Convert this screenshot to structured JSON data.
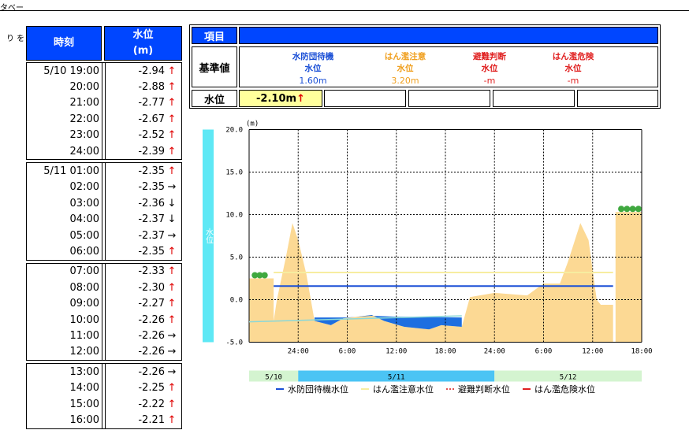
{
  "header": {
    "fragment": "タベー",
    "side_note": "り を"
  },
  "time_table": {
    "col_time": "時刻",
    "col_level": "水位",
    "col_level_unit": "(m)",
    "groups": [
      {
        "rows": [
          {
            "time": "5/10 19:00",
            "value": "-2.94",
            "trend": "↑"
          },
          {
            "time": "20:00",
            "value": "-2.88",
            "trend": "↑"
          },
          {
            "time": "21:00",
            "value": "-2.77",
            "trend": "↑"
          },
          {
            "time": "22:00",
            "value": "-2.67",
            "trend": "↑"
          },
          {
            "time": "23:00",
            "value": "-2.52",
            "trend": "↑"
          },
          {
            "time": "24:00",
            "value": "-2.39",
            "trend": "↑"
          }
        ]
      },
      {
        "rows": [
          {
            "time": "5/11 01:00",
            "value": "-2.35",
            "trend": "↑"
          },
          {
            "time": "02:00",
            "value": "-2.35",
            "trend": "→"
          },
          {
            "time": "03:00",
            "value": "-2.36",
            "trend": "↓"
          },
          {
            "time": "04:00",
            "value": "-2.37",
            "trend": "↓"
          },
          {
            "time": "05:00",
            "value": "-2.37",
            "trend": "→"
          },
          {
            "time": "06:00",
            "value": "-2.35",
            "trend": "↑"
          }
        ]
      },
      {
        "rows": [
          {
            "time": "07:00",
            "value": "-2.33",
            "trend": "↑"
          },
          {
            "time": "08:00",
            "value": "-2.30",
            "trend": "↑"
          },
          {
            "time": "09:00",
            "value": "-2.27",
            "trend": "↑"
          },
          {
            "time": "10:00",
            "value": "-2.26",
            "trend": "↑"
          },
          {
            "time": "11:00",
            "value": "-2.26",
            "trend": "→"
          },
          {
            "time": "12:00",
            "value": "-2.26",
            "trend": "→"
          }
        ]
      },
      {
        "rows": [
          {
            "time": "13:00",
            "value": "-2.26",
            "trend": "→"
          },
          {
            "time": "14:00",
            "value": "-2.25",
            "trend": "↑"
          },
          {
            "time": "15:00",
            "value": "-2.22",
            "trend": "↑"
          },
          {
            "time": "16:00",
            "value": "-2.21",
            "trend": "↑"
          }
        ]
      }
    ]
  },
  "info": {
    "head_label": "項目",
    "std_label": "基準値",
    "standards": [
      {
        "name": "水防団待機",
        "sub": "水位",
        "value": "1.60m",
        "color": "#1a4fd6"
      },
      {
        "name": "はん濫注意",
        "sub": "水位",
        "value": "3.20m",
        "color": "#f0a020"
      },
      {
        "name": "避難判断",
        "sub": "水位",
        "value": "-m",
        "color": "#e02020"
      },
      {
        "name": "はん濫危険",
        "sub": "水位",
        "value": "-m",
        "color": "#e02020"
      }
    ],
    "level_label": "水位",
    "current_level": "-2.10m",
    "current_trend": "↑"
  },
  "chart_data": {
    "type": "area",
    "unit_label": "(m)",
    "axis_title": "水位",
    "ylim": [
      -5.0,
      20.0
    ],
    "yticks": [
      "20.0",
      "15.0",
      "10.0",
      "5.0",
      "0.0",
      "-5.0"
    ],
    "xticks": [
      "24:00",
      "6:00",
      "12:00",
      "18:00",
      "24:00",
      "6:00",
      "12:00",
      "18:00"
    ],
    "xlim_hours": [
      -6,
      42
    ],
    "days": [
      "5/10",
      "5/11",
      "5/12"
    ],
    "grid": true,
    "terrain": [
      {
        "x": -6,
        "y": -5
      },
      {
        "x": -6,
        "y": 2.5
      },
      {
        "x": -3,
        "y": 2.5
      },
      {
        "x": -3,
        "y": -2.5
      },
      {
        "x": -2.6,
        "y": 0
      },
      {
        "x": -1.5,
        "y": 5
      },
      {
        "x": -0.7,
        "y": 9
      },
      {
        "x": 0,
        "y": 7
      },
      {
        "x": 1,
        "y": 3
      },
      {
        "x": 2,
        "y": -2.5
      },
      {
        "x": 4,
        "y": -3
      },
      {
        "x": 5.5,
        "y": -2.2
      },
      {
        "x": 9,
        "y": -1.8
      },
      {
        "x": 10.5,
        "y": -2.5
      },
      {
        "x": 13,
        "y": -3.2
      },
      {
        "x": 16,
        "y": -3.5
      },
      {
        "x": 17.5,
        "y": -3.0
      },
      {
        "x": 20,
        "y": -3.2
      },
      {
        "x": 21,
        "y": 0.3
      },
      {
        "x": 24,
        "y": 0.8
      },
      {
        "x": 28,
        "y": 0.5
      },
      {
        "x": 30,
        "y": 1.9
      },
      {
        "x": 32,
        "y": 1.9
      },
      {
        "x": 33,
        "y": 4.5
      },
      {
        "x": 34.5,
        "y": 9
      },
      {
        "x": 35.5,
        "y": 7
      },
      {
        "x": 36.5,
        "y": 0
      },
      {
        "x": 37,
        "y": -0.6
      },
      {
        "x": 38.5,
        "y": -0.6
      },
      {
        "x": 38.5,
        "y": -5
      }
    ],
    "terrain_right": [
      {
        "x": 38.8,
        "y": -5
      },
      {
        "x": 38.8,
        "y": 10.3
      },
      {
        "x": 42,
        "y": 10.3
      },
      {
        "x": 42,
        "y": -5
      }
    ],
    "water_level": [
      {
        "x": 2,
        "y": -2.1
      },
      {
        "x": 6,
        "y": -2.1
      },
      {
        "x": 9,
        "y": -1.9
      },
      {
        "x": 12,
        "y": -2.0
      },
      {
        "x": 20,
        "y": -2.1
      }
    ],
    "series": [
      {
        "name": "水防団待機水位",
        "value": 1.6,
        "color": "#1a4fd6",
        "x": [
          -3,
          38.5
        ]
      },
      {
        "name": "はん濫注意水位",
        "value": 3.2,
        "color": "#f7eda0",
        "x": [
          -3,
          38.5
        ]
      },
      {
        "name": "避難判断水位",
        "color": "#e05050"
      },
      {
        "name": "はん濫危険水位",
        "color": "#e02020"
      }
    ],
    "colors": {
      "terrain": "#fcd994",
      "water": "#1e6fe0",
      "axis_bar": "#5ee8f5",
      "day1": "#d4f4d0",
      "day2": "#4bc4f4",
      "day3": "#d4f4d0"
    }
  }
}
